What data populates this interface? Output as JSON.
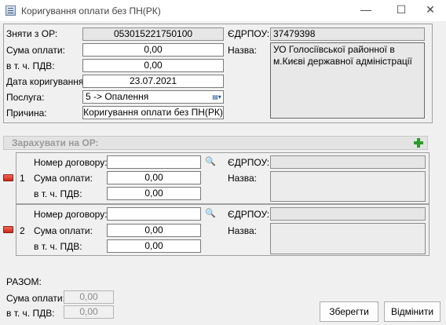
{
  "window": {
    "title": "Коригування оплати без ПН(РК)",
    "minimize_glyph": "—",
    "maximize_glyph": "☐",
    "close_glyph": "✕"
  },
  "form": {
    "znyaty_label": "Зняти з ОР:",
    "znyaty_value": "053015221750100",
    "edrpou_label": "ЄДРПОУ:",
    "edrpou_value": "37479398",
    "suma_label": "Сума оплати:",
    "suma_value": "0,00",
    "pdv_label": "в т. ч. ПДВ:",
    "pdv_value": "0,00",
    "nazva_label": "Назва:",
    "nazva_value": "УО Голосіївської районної в м.Києві державної адміністрації",
    "date_label": "Дата коригування:",
    "date_value": "23.07.2021",
    "posluga_label": "Послуга:",
    "posluga_value": "5 -> Опалення",
    "prychyna_label": "Причина:",
    "prychyna_value": "Коригування оплати без ПН(РК)"
  },
  "transfer": {
    "section_label": "Зарахувати на ОР:",
    "rows": [
      {
        "index": "1",
        "dogovir_label": "Номер договору:",
        "dogovir_value": "",
        "suma_label": "Сума оплати:",
        "suma_value": "0,00",
        "pdv_label": "в т. ч. ПДВ:",
        "pdv_value": "0,00",
        "edrpou_label": "ЄДРПОУ:",
        "edrpou_value": "",
        "nazva_label": "Назва:",
        "nazva_value": ""
      },
      {
        "index": "2",
        "dogovir_label": "Номер договору:",
        "dogovir_value": "",
        "suma_label": "Сума оплати:",
        "suma_value": "0,00",
        "pdv_label": "в т. ч. ПДВ:",
        "pdv_value": "0,00",
        "edrpou_label": "ЄДРПОУ:",
        "edrpou_value": "",
        "nazva_label": "Назва:",
        "nazva_value": ""
      }
    ]
  },
  "totals": {
    "label": "РАЗОМ:",
    "suma_label": "Сума оплати:",
    "suma_value": "0,00",
    "pdv_label": "в т. ч. ПДВ:",
    "pdv_value": "0,00"
  },
  "buttons": {
    "save": "Зберегти",
    "cancel": "Відмінити"
  },
  "icons": {
    "add": "plus-icon",
    "remove": "minus-icon",
    "search": "binoculars-icon",
    "dropdown": "dropdown-arrow-icon",
    "app": "window-app-icon"
  },
  "colors": {
    "add_green": "#2b9a2b",
    "remove_red": "#c9251a",
    "search_blue": "#1d3e8c"
  }
}
